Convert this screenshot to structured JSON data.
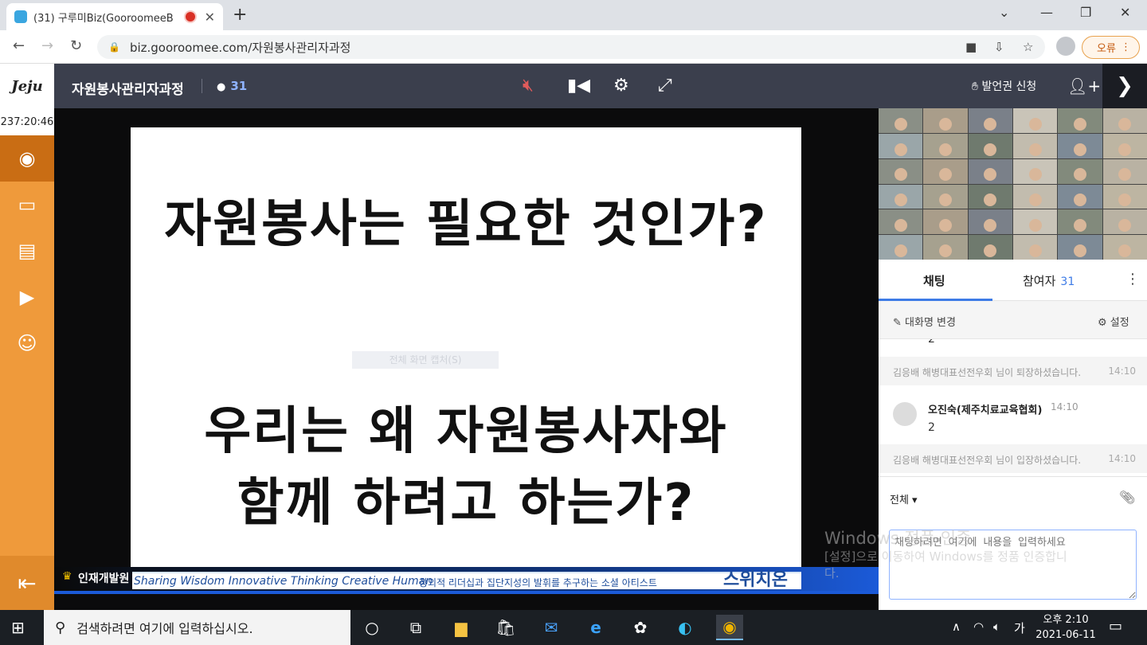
{
  "browser": {
    "tab_title": "(31) 구루미Biz(GooroomeeB",
    "url": "biz.gooroomee.com/자원봉사관리자과정",
    "error_label": "오류"
  },
  "app": {
    "logo_text": "Jeju",
    "room_title": "자원봉사관리자과정",
    "participant_count": "31",
    "speak_request": "발언권 신청",
    "timer": "237:20:46"
  },
  "slide": {
    "line1": "자원봉사는 필요한 것인가?",
    "line2": "우리는 왜 자원봉사자와",
    "line3": "함께 하려고 하는가?",
    "ghost_menu": "전체 화면 캡처(S)",
    "banner_org": "인재개발원",
    "tagline_en": "Sharing Wisdom Innovative Thinking Creative Human",
    "tagline_ko": "창의적 리더십과 집단지성의 발휘를 추구하는 소셜 아티스트",
    "brand": "스위치온"
  },
  "panel": {
    "tab_chat": "채팅",
    "tab_participants": "참여자",
    "participants_count": "31",
    "rename": "대화명 변경",
    "settings": "설정",
    "partial_msg": "2",
    "messages": [
      {
        "type": "system",
        "text": "김응배 해병대표선전우회 님이 퇴장하셨습니다.",
        "time": "14:10"
      },
      {
        "type": "user",
        "name": "오진숙(제주치료교육협회)",
        "time": "14:10",
        "text": "2"
      },
      {
        "type": "system",
        "text": "김응배 해병대표선전우회 님이 입장하셨습니다.",
        "time": "14:10"
      }
    ],
    "target": "전체",
    "input_placeholder": "채팅하려면 여기에 내용을 입력하세요"
  },
  "watermark": {
    "line1": "Windows 정품 인증",
    "line2": "[설정]으로 이동하여 Windows를 정품 인증합니",
    "line3": "다."
  },
  "taskbar": {
    "search_placeholder": "검색하려면 여기에 입력하십시오.",
    "ime": "가",
    "time": "오후 2:10",
    "date": "2021-06-11"
  }
}
